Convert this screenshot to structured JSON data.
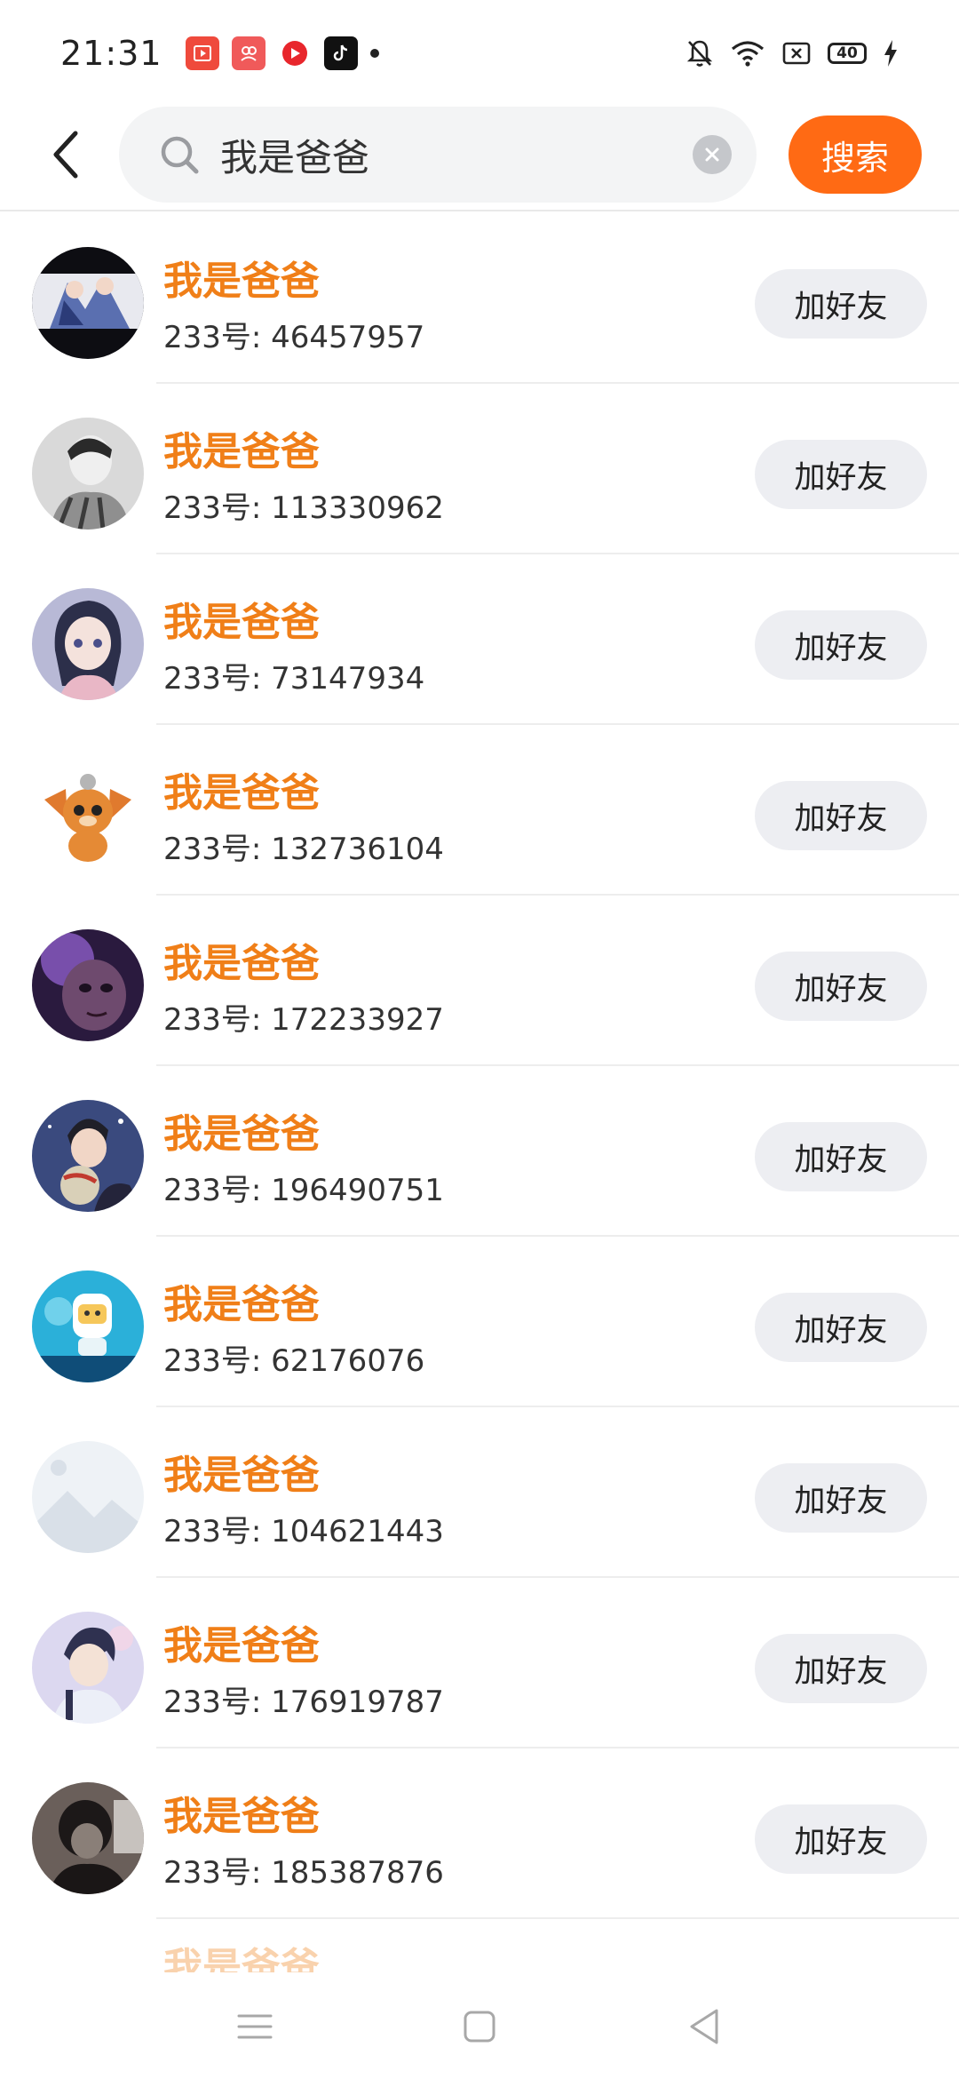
{
  "status_bar": {
    "time": "21:31",
    "battery": "40",
    "icons": [
      "app-video-icon",
      "app-community-icon",
      "app-record-icon",
      "tiktok-icon",
      "mute-bell-icon",
      "wifi-icon",
      "no-sim-icon",
      "charging-icon"
    ]
  },
  "header": {
    "back_icon": "back-arrow-icon",
    "search_query": "我是爸爸",
    "search_button": "搜索"
  },
  "results": [
    {
      "name": "我是爸爸",
      "id": "233号: 46457957",
      "action": "加好友"
    },
    {
      "name": "我是爸爸",
      "id": "233号: 113330962",
      "action": "加好友"
    },
    {
      "name": "我是爸爸",
      "id": "233号: 73147934",
      "action": "加好友"
    },
    {
      "name": "我是爸爸",
      "id": "233号: 132736104",
      "action": "加好友"
    },
    {
      "name": "我是爸爸",
      "id": "233号: 172233927",
      "action": "加好友"
    },
    {
      "name": "我是爸爸",
      "id": "233号: 196490751",
      "action": "加好友"
    },
    {
      "name": "我是爸爸",
      "id": "233号: 62176076",
      "action": "加好友"
    },
    {
      "name": "我是爸爸",
      "id": "233号: 104621443",
      "action": "加好友"
    },
    {
      "name": "我是爸爸",
      "id": "233号: 176919787",
      "action": "加好友"
    },
    {
      "name": "我是爸爸",
      "id": "233号: 185387876",
      "action": "加好友"
    }
  ],
  "partial_result": {
    "name": "我是爸爸"
  },
  "nav_bar": [
    "menu-icon",
    "home-icon",
    "back-triangle-icon"
  ],
  "colors": {
    "accent": "#ff6a14",
    "name_text": "#f07f18",
    "button_bg": "#edeef2"
  }
}
